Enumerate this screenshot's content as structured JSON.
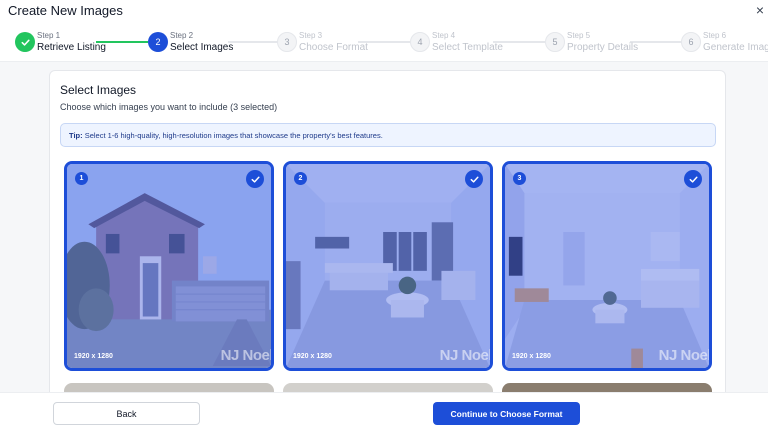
{
  "modal": {
    "title": "Create New Images",
    "close_symbol": "×"
  },
  "steps": [
    {
      "number": "Step 1",
      "label": "Retrieve Listing",
      "status": "done"
    },
    {
      "number": "Step 2",
      "label": "Select Images",
      "status": "active",
      "circle": "2"
    },
    {
      "number": "Step 3",
      "label": "Choose Format",
      "status": "pending",
      "circle": "3"
    },
    {
      "number": "Step 4",
      "label": "Select Template",
      "status": "pending",
      "circle": "4"
    },
    {
      "number": "Step 5",
      "label": "Property Details",
      "status": "pending",
      "circle": "5"
    },
    {
      "number": "Step 6",
      "label": "Generate Images",
      "status": "pending",
      "circle": "6"
    }
  ],
  "select_images": {
    "title": "Select Images",
    "subtitle": "Choose which images you want to include (3 selected)",
    "tip_label": "Tip:",
    "tip_text": " Select 1-6 high-quality, high-resolution images that showcase the property's best features."
  },
  "images": [
    {
      "index": "1",
      "dimensions": "1920 x 1280",
      "watermark": "NJ Noel",
      "selected": true,
      "scene": "house-exterior"
    },
    {
      "index": "2",
      "dimensions": "1920 x 1280",
      "watermark": "NJ Noel",
      "selected": true,
      "scene": "living-room"
    },
    {
      "index": "3",
      "dimensions": "1920 x 1280",
      "watermark": "NJ Noel",
      "selected": true,
      "scene": "living-room-tv"
    }
  ],
  "footer": {
    "back_label": "Back",
    "continue_label": "Continue to Choose Format"
  },
  "colors": {
    "primary": "#1d4ed8",
    "success": "#22c55e",
    "tip_bg": "#eef4ff"
  },
  "icons": {
    "done_step": "check-icon",
    "selected_tile": "check-icon",
    "close": "close-icon"
  }
}
